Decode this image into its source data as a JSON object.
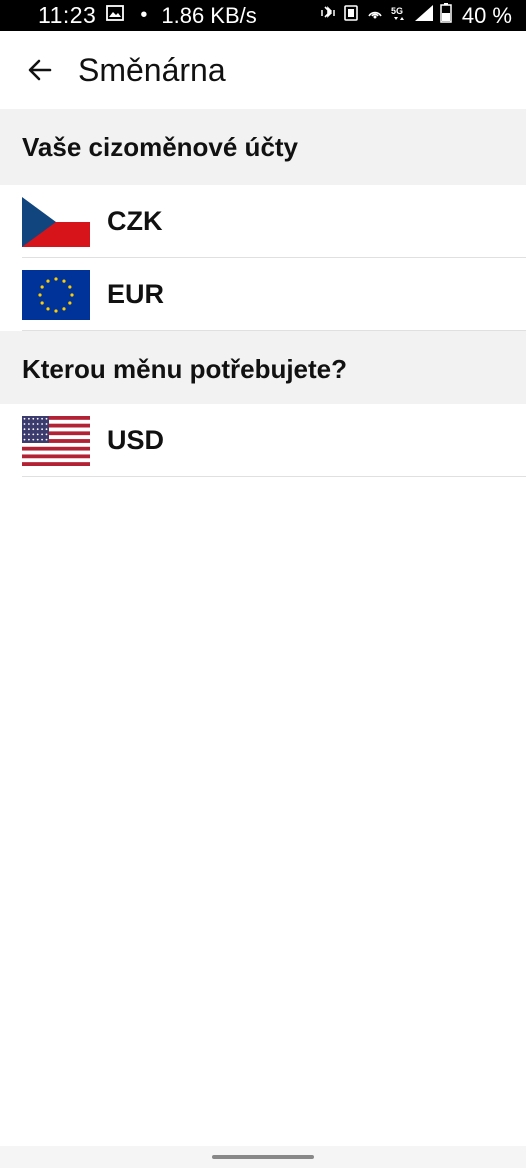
{
  "status_bar": {
    "time": "11:23",
    "dot": "•",
    "speed": "1.86 KB/s",
    "battery": "40 %"
  },
  "app_bar": {
    "title": "Směnárna"
  },
  "accounts_section": {
    "title": "Vaše cizoměnové účty",
    "items": [
      {
        "code": "CZK",
        "flag": "czech-flag"
      },
      {
        "code": "EUR",
        "flag": "eu-flag"
      }
    ]
  },
  "target_section": {
    "title": "Kterou měnu potřebujete?",
    "items": [
      {
        "code": "USD",
        "flag": "us-flag"
      }
    ]
  },
  "colors": {
    "status_bar_bg": "#000000",
    "section_bg": "#f2f2f2",
    "czech_blue": "#11457e",
    "czech_red": "#d7141a",
    "eu_blue": "#003399",
    "eu_gold": "#ffcc00",
    "us_red": "#b22234",
    "us_blue": "#3c3b6e"
  }
}
